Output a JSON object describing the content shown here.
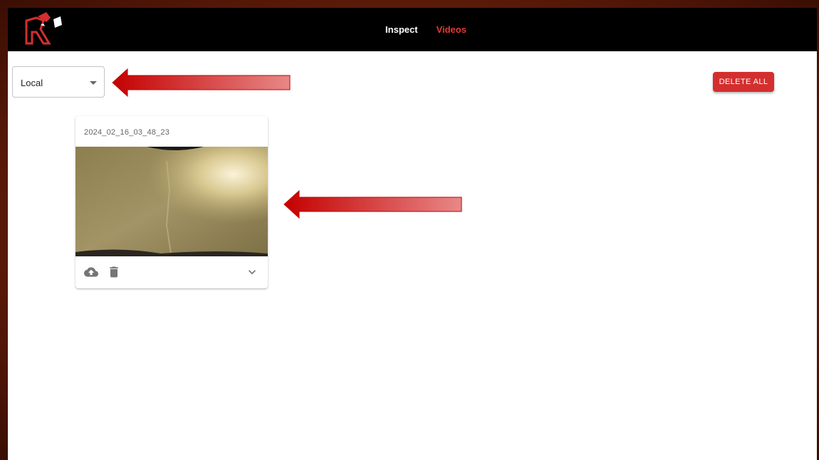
{
  "nav": {
    "inspect_label": "Inspect",
    "videos_label": "Videos",
    "active": "Videos"
  },
  "storage_select": {
    "value": "Local"
  },
  "actions": {
    "delete_all_label": "DELETE ALL"
  },
  "videos": [
    {
      "title": "2024_02_16_03_48_23",
      "icons": [
        "cloud-upload-icon",
        "trash-icon",
        "chevron-down-icon"
      ]
    }
  ],
  "colors": {
    "accent": "#e53935",
    "button_red": "#d32f2f",
    "topbar": "#000000",
    "annotation_arrow": "#cc0000"
  }
}
